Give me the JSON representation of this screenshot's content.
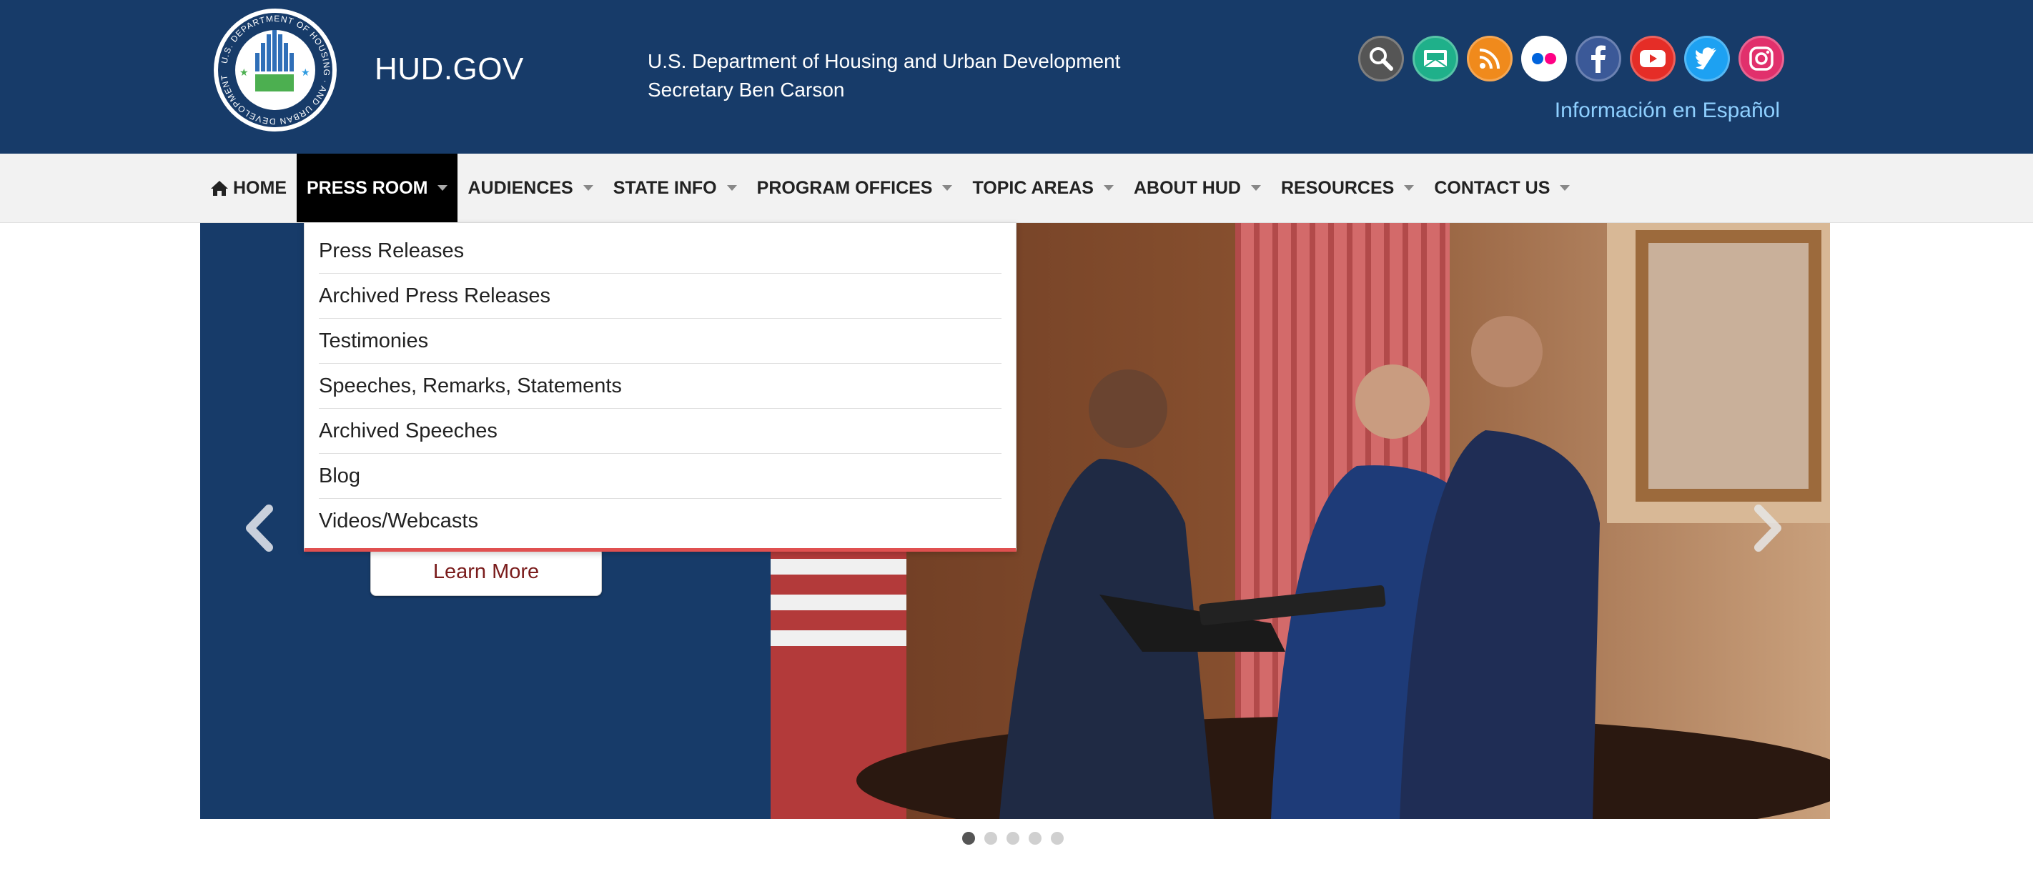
{
  "header": {
    "site_title": "HUD.GOV",
    "department": "U.S. Department of Housing and Urban Development",
    "secretary": "Secretary Ben Carson",
    "spanish_link": "Información en Español",
    "seal_text": "U.S. DEPARTMENT OF HOUSING AND URBAN DEVELOPMENT",
    "social_icons": [
      {
        "name": "search-icon",
        "color": "#555555"
      },
      {
        "name": "email-updates-icon",
        "color": "#1fb08a"
      },
      {
        "name": "rss-icon",
        "color": "#f08a1c"
      },
      {
        "name": "flickr-icon",
        "color": "#ffffff"
      },
      {
        "name": "facebook-icon",
        "color": "#3b5998"
      },
      {
        "name": "youtube-icon",
        "color": "#e52d27"
      },
      {
        "name": "twitter-icon",
        "color": "#1da1f2"
      },
      {
        "name": "instagram-icon",
        "color": "#e1306c"
      }
    ]
  },
  "nav": {
    "items": [
      {
        "label": "HOME"
      },
      {
        "label": "PRESS ROOM"
      },
      {
        "label": "AUDIENCES"
      },
      {
        "label": "STATE INFO"
      },
      {
        "label": "PROGRAM OFFICES"
      },
      {
        "label": "TOPIC AREAS"
      },
      {
        "label": "ABOUT HUD"
      },
      {
        "label": "RESOURCES"
      },
      {
        "label": "CONTACT US"
      }
    ]
  },
  "dropdown": {
    "items": [
      {
        "label": "Press Releases"
      },
      {
        "label": "Archived Press Releases"
      },
      {
        "label": "Testimonies"
      },
      {
        "label": "Speeches, Remarks, Statements"
      },
      {
        "label": "Archived Speeches"
      },
      {
        "label": "Blog"
      },
      {
        "label": "Videos/Webcasts"
      }
    ]
  },
  "hero": {
    "button_label": "Learn More",
    "active_slide": 1,
    "slide_count": 5
  },
  "colors": {
    "header_bg": "#173b69",
    "nav_bg": "#f2f2f2",
    "active_nav_bg": "#000000",
    "dropdown_accent": "#e05050",
    "link_light_blue": "#8fd0ff"
  }
}
